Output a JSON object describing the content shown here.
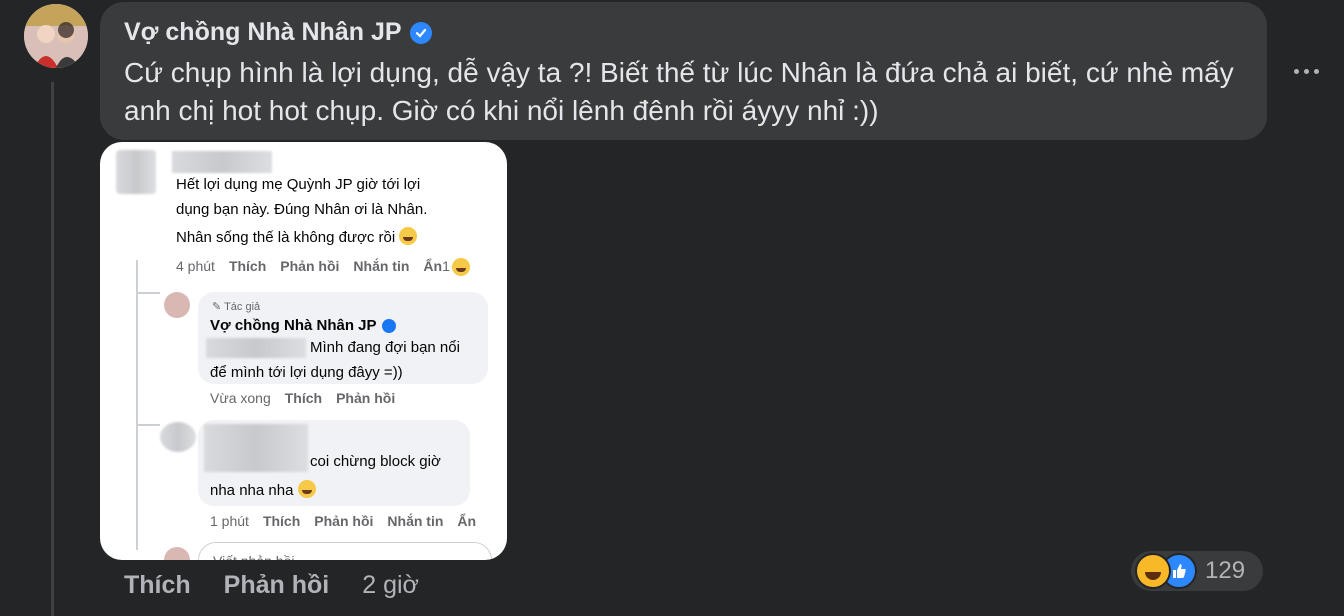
{
  "comment": {
    "author": "Vợ chồng Nhà Nhân JP",
    "text": "Cứ chụp hình là lợi dụng, dễ vậy ta ?! Biết thế từ lúc Nhân là đứa chả ai biết, cứ nhè mấy anh chị hot hot chụp. Giờ có khi nổi lênh đênh rồi áyyy nhỉ :))",
    "actions": {
      "like": "Thích",
      "reply": "Phản hồi",
      "time": "2 giờ"
    },
    "reactions": {
      "icons": [
        "haha-icon",
        "like-icon"
      ],
      "count": "129"
    }
  },
  "screenshot": {
    "comment1": {
      "text_line1": "Hết lợi dụng mẹ Quỳnh JP giờ tới lợi",
      "text_line2": "dụng bạn này. Đúng Nhân ơi là Nhân.",
      "text_line3": "Nhân sống thế là không được rồi",
      "actions": {
        "time": "4 phút",
        "like": "Thích",
        "reply": "Phản hồi",
        "message": "Nhắn tin",
        "hide": "Ẩn",
        "count": "1"
      }
    },
    "reply1": {
      "badge": "Tác giả",
      "author": "Vợ chồng Nhà Nhân JP",
      "text_line1": "Mình đang đợi bạn nổi",
      "text_line2": "để mình tới lợi dụng đâyy =))",
      "actions": {
        "time": "Vừa xong",
        "like": "Thích",
        "reply": "Phản hồi"
      }
    },
    "reply2": {
      "text_line1": "coi chừng block giờ",
      "text_line2": "nha nha nha",
      "actions": {
        "time": "1 phút",
        "like": "Thích",
        "reply": "Phản hồi",
        "message": "Nhắn tin",
        "hide": "Ẩn"
      }
    },
    "composer_placeholder": "Viết phản hồi..."
  },
  "colors": {
    "background": "#242526",
    "bubble": "#3a3b3c",
    "verified": "#2d88ff",
    "muted": "#b0b3b8"
  }
}
